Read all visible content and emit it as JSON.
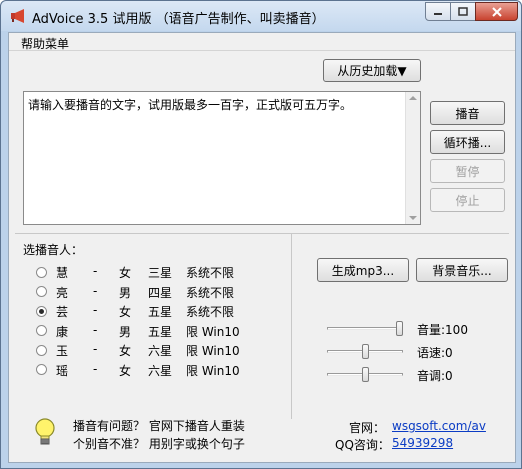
{
  "window": {
    "title": "AdVoice 3.5 试用版 （语音广告制作、叫卖播音）"
  },
  "menu": {
    "help": "帮助菜单"
  },
  "history_button": "从历史加载▼",
  "input": {
    "text": "请输入要播音的文字，试用版最多一百字，正式版可五万字。"
  },
  "actions": {
    "play": "播音",
    "loop": "循环播...",
    "pause": "暂停",
    "stop": "停止"
  },
  "speaker": {
    "label": "选播音人：",
    "selected": "芸",
    "items": [
      {
        "name": "慧",
        "dash": "-",
        "gender": "女",
        "stars": "三星",
        "limit": "系统不限"
      },
      {
        "name": "亮",
        "dash": "-",
        "gender": "男",
        "stars": "四星",
        "limit": "系统不限"
      },
      {
        "name": "芸",
        "dash": "-",
        "gender": "女",
        "stars": "五星",
        "limit": "系统不限"
      },
      {
        "name": "康",
        "dash": "-",
        "gender": "男",
        "stars": "五星",
        "limit": "限 Win10"
      },
      {
        "name": "玉",
        "dash": "-",
        "gender": "女",
        "stars": "六星",
        "limit": "限 Win10"
      },
      {
        "name": "瑶",
        "dash": "-",
        "gender": "女",
        "stars": "六星",
        "limit": "限 Win10"
      }
    ]
  },
  "buttons": {
    "gen_mp3": "生成mp3...",
    "bg_music": "背景音乐..."
  },
  "sliders": {
    "volume": {
      "label": "音量:100",
      "fraction": 1.0
    },
    "speed": {
      "label": "语速:0",
      "fraction": 0.5
    },
    "pitch": {
      "label": "音调:0",
      "fraction": 0.5
    }
  },
  "hint": {
    "line1": "播音有问题？ 官网下播音人重装",
    "line2": "个别音不准？ 用别字或换个句子"
  },
  "info": {
    "site_label": "官网：",
    "site_value": "wsgsoft.com/av",
    "qq_label": "QQ咨询：",
    "qq_value": "54939298"
  }
}
